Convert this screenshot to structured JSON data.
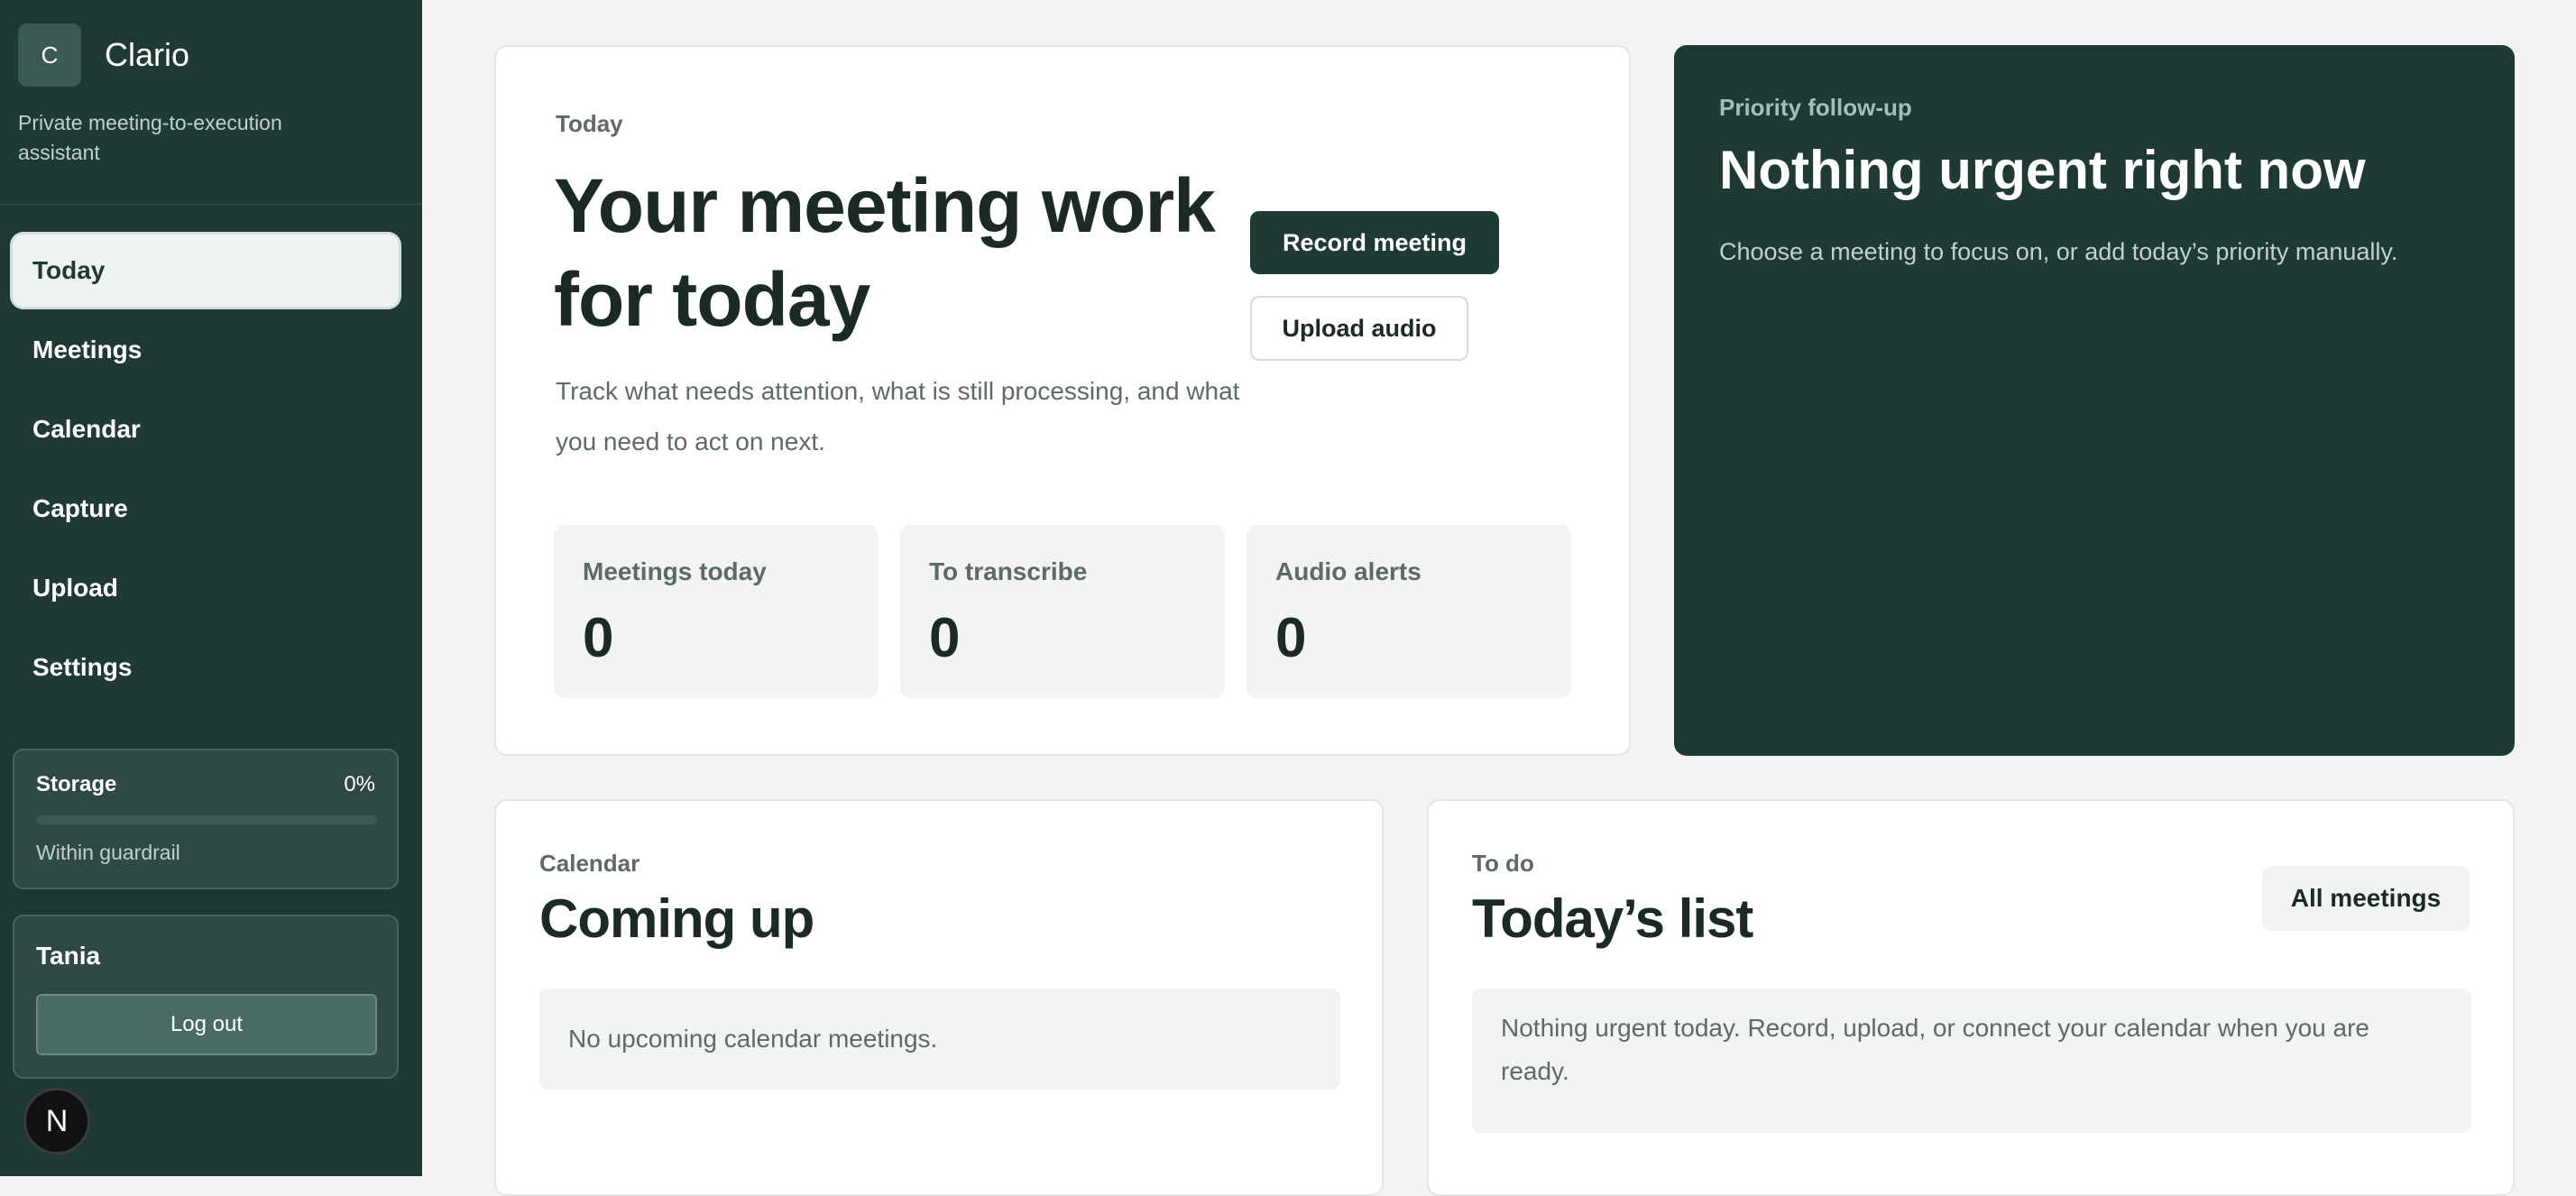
{
  "app": {
    "logo_letter": "C",
    "name": "Clario",
    "tagline": "Private meeting-to-execution assistant"
  },
  "sidebar": {
    "items": [
      {
        "label": "Today",
        "active": true
      },
      {
        "label": "Meetings"
      },
      {
        "label": "Calendar"
      },
      {
        "label": "Capture"
      },
      {
        "label": "Upload"
      },
      {
        "label": "Settings"
      }
    ],
    "storage": {
      "label": "Storage",
      "percent_text": "0%",
      "percent": 0,
      "note": "Within guardrail"
    },
    "user": {
      "name": "Tania",
      "logout_label": "Log out"
    },
    "dev_badge": "N"
  },
  "hero": {
    "eyebrow": "Today",
    "title": "Your meeting work for today",
    "description": "Track what needs attention, what is still processing, and what you need to act on next.",
    "record_label": "Record meeting",
    "upload_label": "Upload audio",
    "stats": [
      {
        "label": "Meetings today",
        "value": "0"
      },
      {
        "label": "To transcribe",
        "value": "0"
      },
      {
        "label": "Audio alerts",
        "value": "0"
      }
    ]
  },
  "priority": {
    "eyebrow": "Priority follow-up",
    "title": "Nothing urgent right now",
    "description": "Choose a meeting to focus on, or add today’s priority manually."
  },
  "upcoming": {
    "eyebrow": "Calendar",
    "title": "Coming up",
    "empty": "No upcoming calendar meetings."
  },
  "todo": {
    "eyebrow": "To do",
    "title": "Today’s list",
    "all_meetings_label": "All meetings",
    "empty": "Nothing urgent today. Record, upload, or connect your calendar when you are ready."
  },
  "colors": {
    "sidebar_bg": "#1f3a35",
    "page_bg": "#f3f4f1",
    "accent": "#1f3a35"
  }
}
